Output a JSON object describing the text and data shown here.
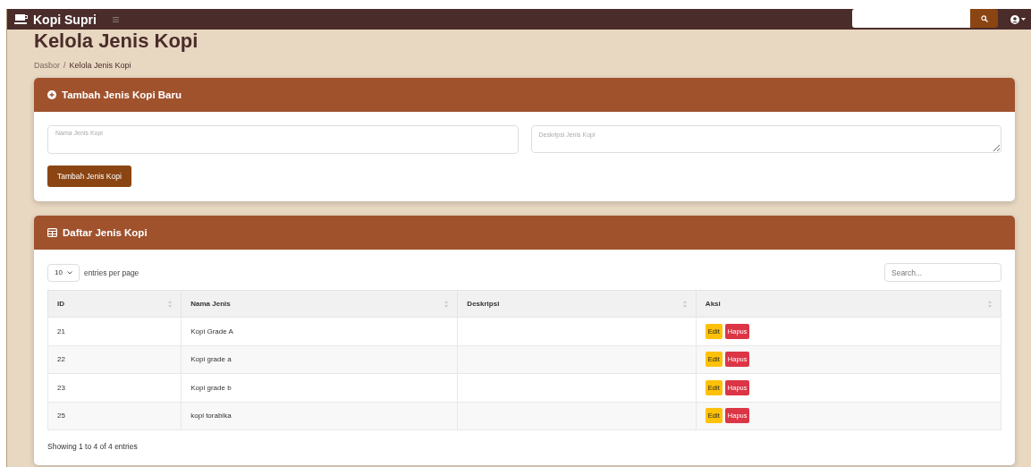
{
  "navbar": {
    "brand": "Kopi Supri"
  },
  "page": {
    "title": "Kelola Jenis Kopi",
    "breadcrumb_separator": "/",
    "breadcrumb": [
      {
        "label": "Dasbor",
        "selected": false
      },
      {
        "label": "Kelola Jenis Kopi",
        "selected": true
      }
    ]
  },
  "add_card": {
    "title": "Tambah Jenis Kopi Baru",
    "name_field": {
      "placeholder": "Nama Jenis Kopi"
    },
    "description_field": {
      "placeholder": "Deskripsi Jenis Kopi"
    },
    "submit": "Tambah Jenis Kopi"
  },
  "list_card": {
    "title": "Daftar Jenis Kopi",
    "page_size": "10",
    "page_size_label": "entries per page",
    "search": {
      "placeholder": "Search..."
    },
    "columns": [
      "ID",
      "Nama Jenis",
      "Deskripsi",
      "Aksi"
    ],
    "rows": [
      {
        "id": "21",
        "name": "Kopi Grade A",
        "description": "",
        "actions": [
          "Edit",
          "Hapus"
        ]
      },
      {
        "id": "22",
        "name": "Kopi grade a",
        "description": "",
        "actions": [
          "Edit",
          "Hapus"
        ]
      },
      {
        "id": "23",
        "name": "Kopi grade b",
        "description": "",
        "actions": [
          "Edit",
          "Hapus"
        ]
      },
      {
        "id": "25",
        "name": "kopi torabika",
        "description": "",
        "actions": [
          "Edit",
          "Hapus"
        ]
      }
    ],
    "footer": "Showing 1 to 4 of 4 entries"
  }
}
